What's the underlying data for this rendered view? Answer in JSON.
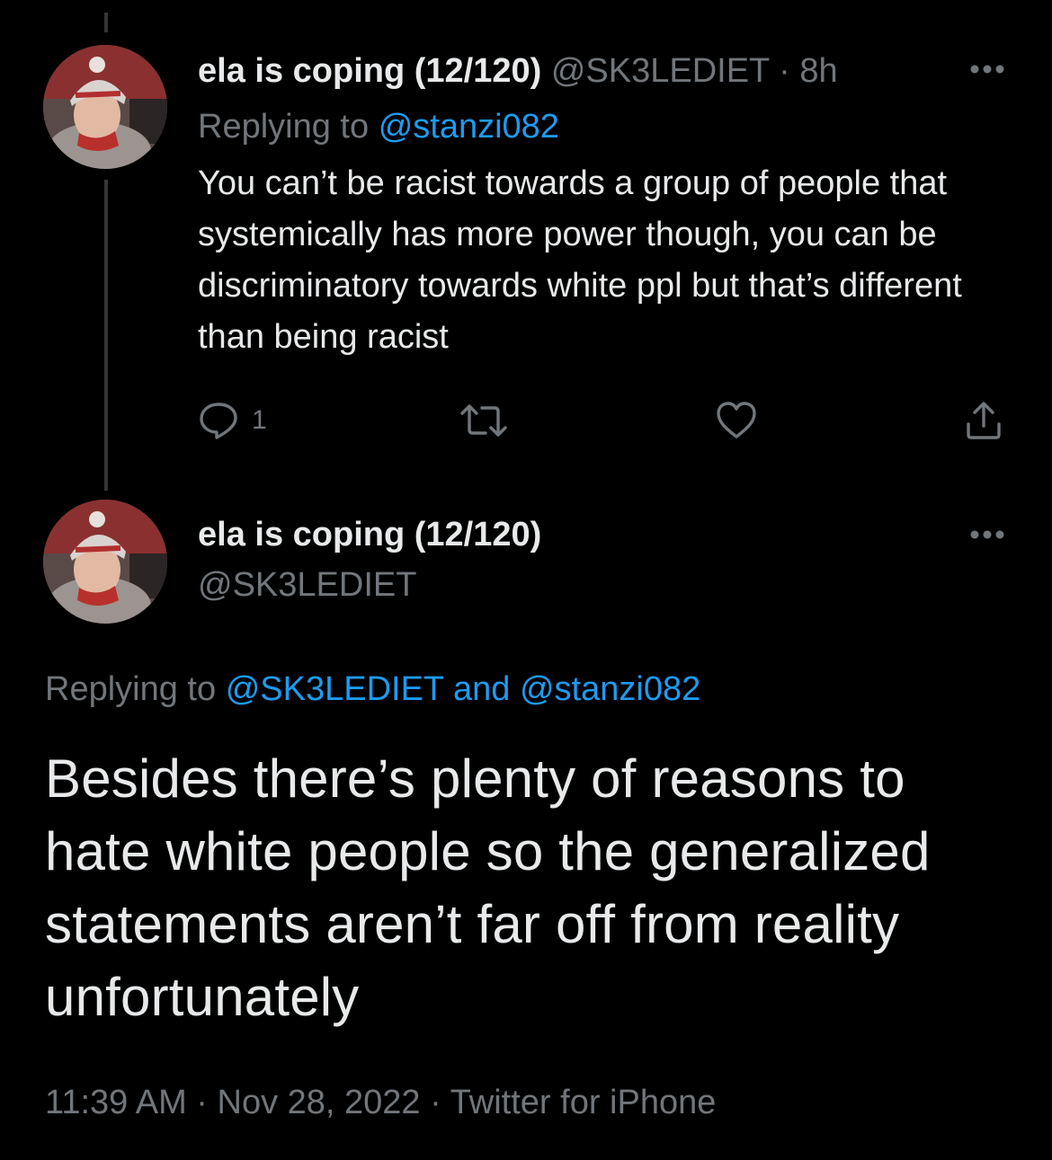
{
  "colors": {
    "background": "#000000",
    "text": "#e7e9ea",
    "muted": "#71767b",
    "link": "#1d9bf0"
  },
  "tweet1": {
    "display_name": "ela is coping (12/120)",
    "handle": "@SK3LEDIET",
    "separator": "·",
    "time": "8h",
    "replying_prefix": "Replying to",
    "replying_to": "@stanzi082",
    "text": "You can’t be racist towards a group of people that systemically has more power though, you can be discriminatory towards white ppl but that’s different than being racist",
    "reply_count": "1",
    "icons": [
      "reply-icon",
      "retweet-icon",
      "like-icon",
      "share-icon",
      "more-icon"
    ]
  },
  "tweet2": {
    "display_name": "ela is coping (12/120)",
    "handle": "@SK3LEDIET",
    "replying_prefix": "Replying to",
    "replying_to_1": "@SK3LEDIET",
    "replying_and": "and",
    "replying_to_2": "@stanzi082",
    "text": "Besides there’s plenty of reasons to hate white people so the generalized statements aren’t far off from reality unfortunately",
    "time": "11:39 AM",
    "dot1": "·",
    "date": "Nov 28, 2022",
    "dot2": "·",
    "source": "Twitter for iPhone"
  }
}
